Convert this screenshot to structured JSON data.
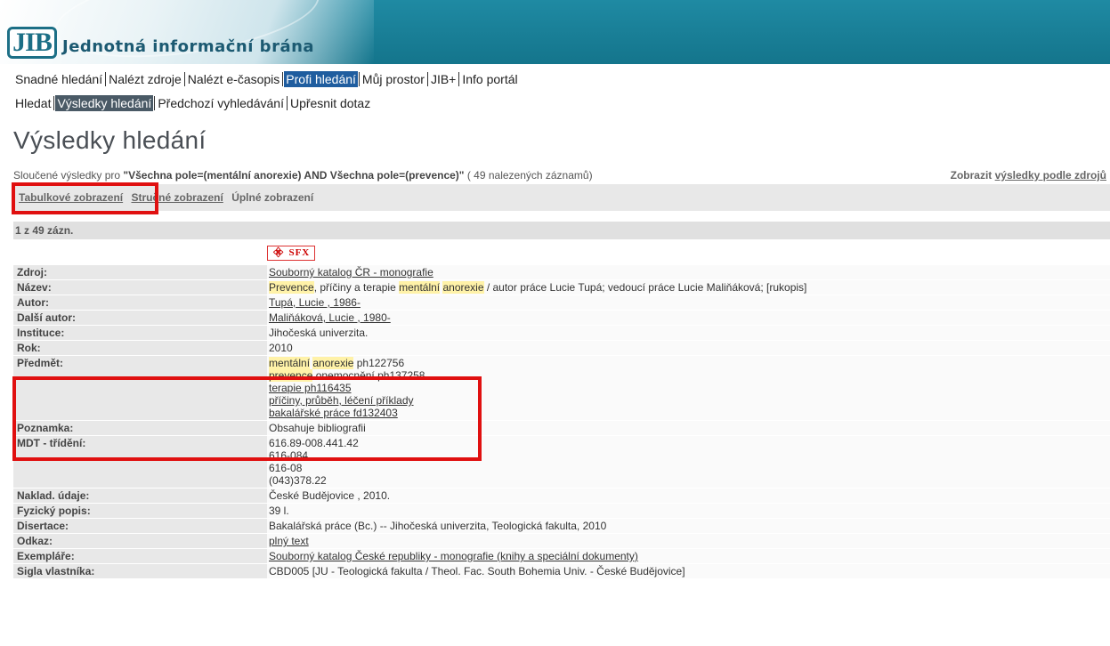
{
  "header": {
    "logo": "JIB",
    "title": "Jednotná informační brána"
  },
  "nav1": [
    "Snadné hledání",
    "Nalézt zdroje",
    "Nalézt e-časopis",
    "Profi hledání",
    "Můj prostor",
    "JIB+",
    "Info portál"
  ],
  "nav2": [
    "Hledat",
    "Výsledky hledání",
    "Předchozí vyhledávání",
    "Upřesnit dotaz"
  ],
  "page_title": "Výsledky hledání",
  "summary": {
    "prefix": "Sloučené výsledky pro",
    "query": "\"Všechna pole=(mentální anorexie) AND Všechna pole=(prevence)\"",
    "count": "( 49 nalezených záznamů)",
    "right_label": "Zobrazit",
    "right_link": "výsledky podle zdrojů"
  },
  "views": {
    "table": "Tabulkové zobrazení",
    "brief": "Stručné zobrazení",
    "full": "Úplné zobrazení"
  },
  "record_count": "1 z 49 zázn.",
  "sfx_label": "SFX",
  "record": {
    "zdroj_label": "Zdroj:",
    "zdroj": "Souborný katalog ČR - monografie",
    "nazev_label": "Název:",
    "nazev_hl1": "Prevence",
    "nazev_mid": ", příčiny a terapie ",
    "nazev_hl2": "mentální",
    "nazev_hl3": "anorexie",
    "nazev_rest": " / autor práce Lucie Tupá; vedoucí práce Lucie Maliňáková; [rukopis]",
    "autor_label": "Autor:",
    "autor": "Tupá, Lucie , 1986-",
    "dalsi_label": "Další autor:",
    "dalsi": "Maliňáková, Lucie , 1980-",
    "instituce_label": "Instituce:",
    "instituce": "Jihočeská univerzita.",
    "rok_label": "Rok:",
    "rok": "2010",
    "predmet_label": "Předmět:",
    "predmet_1_hl1": "mentální",
    "predmet_1_hl2": "anorexie",
    "predmet_1_rest": " ph122756",
    "predmet_2_hl": "prevence",
    "predmet_2_rest": " onemocnění ph137258",
    "predmet_3": "terapie ph116435",
    "predmet_4": "příčiny, průběh, léčení příklady",
    "predmet_5": "bakalářské práce fd132403",
    "poznamka_label": "Poznamka:",
    "poznamka": "Obsahuje bibliografii",
    "mdt_label": "MDT - třídění:",
    "mdt": [
      "616.89-008.441.42",
      "616-084",
      "616-08",
      "(043)378.22"
    ],
    "naklad_label": "Naklad. údaje:",
    "naklad": "České Budějovice , 2010.",
    "fyz_label": "Fyzický popis:",
    "fyz": "39 l.",
    "disertace_label": "Disertace:",
    "disertace": "Bakalářská práce (Bc.) -- Jihočeská univerzita, Teologická fakulta, 2010",
    "odkaz_label": "Odkaz:",
    "odkaz": "plný text",
    "exemplare_label": "Exempláře:",
    "exemplare": "Souborný katalog České republiky - monografie (knihy a speciální dokumenty)",
    "sigla_label": "Sigla vlastníka:",
    "sigla": "CBD005 [JU - Teologická fakulta / Theol. Fac. South Bohemia Univ. - České Budějovice]"
  },
  "colors": {
    "banner": "#1f8aa3",
    "active_nav": "#1f5d9f",
    "highlight": "#fff2a8",
    "annotation_red": "#e01010"
  }
}
